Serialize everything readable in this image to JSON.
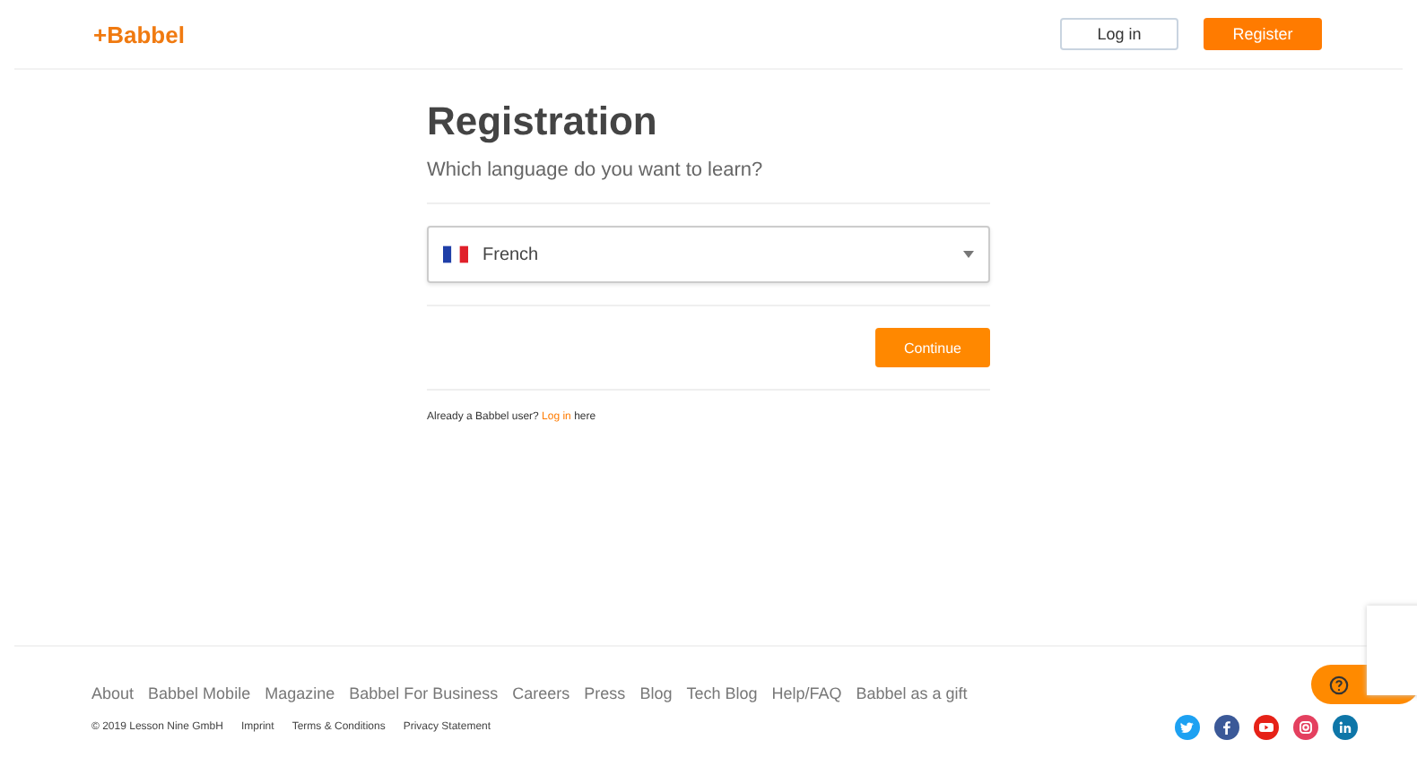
{
  "header": {
    "logo": "+Babbel",
    "login": "Log in",
    "register": "Register"
  },
  "form": {
    "title": "Registration",
    "subtitle": "Which language do you want to learn?",
    "language": "French",
    "continue": "Continue",
    "note_before": "Already a Babbel user?",
    "note_link": "Log in",
    "note_after": "here"
  },
  "footer": {
    "links": [
      "About",
      "Babbel Mobile",
      "Magazine",
      "Babbel For Business",
      "Careers",
      "Press",
      "Blog",
      "Tech Blog",
      "Help/FAQ",
      "Babbel as a gift"
    ],
    "legal": [
      "© 2019 Lesson Nine GmbH",
      "Imprint",
      "Terms & Conditions",
      "Privacy Statement"
    ],
    "social": [
      {
        "kind": "twitter",
        "color": "#1da1f2"
      },
      {
        "kind": "facebook",
        "color": "#3b5998"
      },
      {
        "kind": "youtube",
        "color": "#e62117"
      },
      {
        "kind": "instagram",
        "color": "#e4405f"
      },
      {
        "kind": "linkedin",
        "color": "#0e76a8"
      }
    ]
  }
}
